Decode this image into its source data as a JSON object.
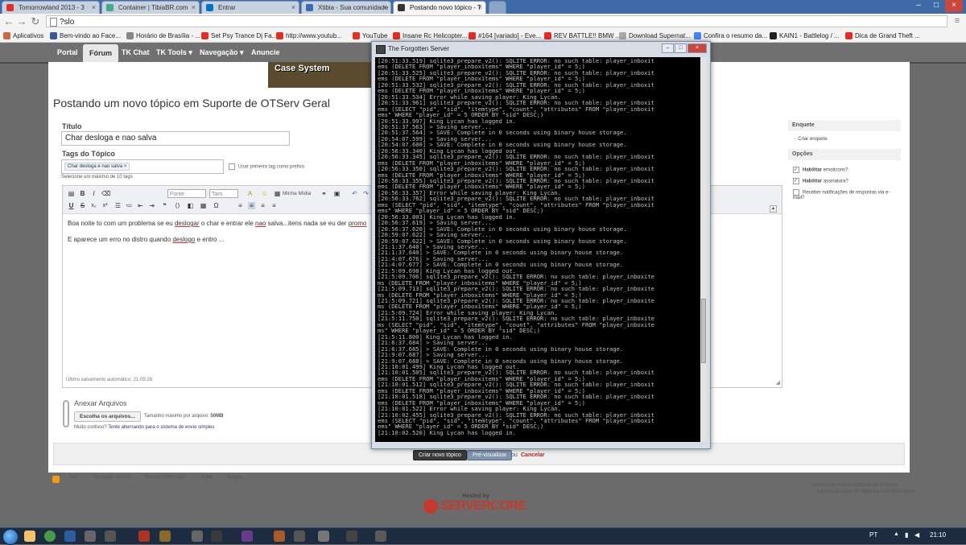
{
  "browser": {
    "tabs": [
      {
        "label": "Tomorrowland 2013 - 3",
        "color": "#e52d27"
      },
      {
        "label": "Container | TibiaBR.com",
        "color": "#4a8"
      },
      {
        "label": "Entrar",
        "color": "#0072c6"
      },
      {
        "label": "Xtibia - Sua comunidade",
        "color": "#3a6ab0"
      },
      {
        "label": "Postando novo tópico - T",
        "color": "#333"
      }
    ],
    "url": "?slo",
    "bookmarks": [
      {
        "label": "Aplicativos",
        "color": "#c64"
      },
      {
        "label": "Bem-vindo ao Face...",
        "color": "#3b5998"
      },
      {
        "label": "Horário de Brasília - ...",
        "color": "#888"
      },
      {
        "label": "Set Psy Trance Dj Fa...",
        "color": "#e52d27"
      },
      {
        "label": "http://www.youtub...",
        "color": "#e52d27"
      },
      {
        "label": "YouTube",
        "color": "#e52d27"
      },
      {
        "label": "Insane Rc Helicopter...",
        "color": "#e52d27"
      },
      {
        "label": "#164 [variado] - Eve...",
        "color": "#e52d27"
      },
      {
        "label": "REV BATTLE!! BMW ...",
        "color": "#e52d27"
      },
      {
        "label": "Download Supernat...",
        "color": "#aaa"
      },
      {
        "label": "Confira o resumo da...",
        "color": "#4285f4"
      },
      {
        "label": "KAIN1 - Battlelog / ...",
        "color": "#222"
      },
      {
        "label": "Dica de Grand Theft ...",
        "color": "#e52d27"
      }
    ]
  },
  "sitenav": [
    "Portal",
    "Fórum",
    "TK Chat",
    "TK Tools ▾",
    "Navegação ▾",
    "Anuncie"
  ],
  "banner_text": "Case System",
  "page": {
    "title": "Postando um novo tópico em Suporte de OTServ Geral",
    "titulo_label": "Título",
    "titulo_value": "Char desloga e nao salva",
    "tags_label": "Tags do Tópico",
    "tag_chip": "Char desloga e nao salva ×",
    "tag_prefix_option": "Usar primeira tag como prefixo",
    "tag_hint": "Selecione um máximo de 10 tags",
    "toolbar": {
      "font": "Fonte",
      "size": "Tam.",
      "media": "Minha Mídia"
    },
    "body_line1_pre": "Boa noite to com um problema se eu ",
    "body_w1": "deslogar",
    "body_line1_mid": " o char e entrar ele ",
    "body_w2": "nao",
    "body_line1_post": " salva...itens nada se eu der ",
    "body_w3": "promo",
    "body_line2_pre": "E aparece um erro no distro quando ",
    "body_w4": "deslogo",
    "body_line2_post": " e entro ...",
    "autosave": "Último salvamento automático: 21:09:26",
    "attach_title": "Anexar Arquivos",
    "choose_files": "Escolha os arquivos...",
    "max_size_label": "Tamanho máximo por arquivo:",
    "max_size_value": "50MB",
    "confused": "Muito confuso?",
    "alt_system": "Tente alternando para o sistema de envio simples",
    "submit": "Criar novo tópico",
    "preview": "Pré-visualizar",
    "or": "ou",
    "cancel": "Cancelar"
  },
  "sidebar": {
    "enquete": "Enquete",
    "criar_enquete": "Criar enquete",
    "opcoes": "Opções",
    "emoticons_bold": "Habilitar",
    "emoticons": "emoticons?",
    "assinatura_bold": "Habilitar",
    "assinatura": "assinatura?",
    "notify": "Receber notificações de respostas via e-mail?"
  },
  "footer": {
    "skin": "Skin",
    "lang": "Português (Brasil)",
    "mark": "Marcar Como Lido",
    "help": "Ajuda",
    "rules": "Regras",
    "software": "Community Forum Software by IP.Board",
    "license": "Licenciado para: © TibiaKing.com 2010-2014",
    "hosted": "Hosted by",
    "servercore": "SERVERCORE"
  },
  "console": {
    "title": "The Forgotten Server",
    "lines": [
      "[20:51:33.519] sqlite3_prepare_v2(): SQLITE ERROR: no such table: player_inboxit",
      "ems (DELETE FROM \"player_inboxitems\" WHERE \"player_id\" = 5;)",
      "[20:51:33.525] sqlite3_prepare_v2(): SQLITE ERROR: no such table: player_inboxit",
      "ems (DELETE FROM \"player_inboxitems\" WHERE \"player_id\" = 5;)",
      "[20:51:33.532] sqlite3_prepare_v2(): SQLITE ERROR: no such table: player_inboxit",
      "ems (DELETE FROM \"player_inboxitems\" WHERE \"player_id\" = 5;)",
      "[20:51:33.534] Error while saving player: King Lycan.",
      "[20:51:33.961] sqlite3_prepare_v2(): SQLITE ERROR: no such table: player_inboxit",
      "ems (SELECT \"pid\", \"sid\", \"itemtype\", \"count\", \"attributes\" FROM \"player_inboxit",
      "ems\" WHERE \"player_id\" = 5 ORDER BY \"sid\" DESC;)",
      "[20:51:33.997] King Lycan has logged in.",
      "[20:51:37.563] > Saving server...",
      "[20:51:37.564] > SAVE: Complete in 0 seconds using binary house storage.",
      "[20:54:07.599] > Saving server...",
      "[20:54:07.600] > SAVE: Complete in 0 seconds using binary house storage.",
      "[20:56:33.340] King Lycan has logged out.",
      "[20:56:33.345] sqlite3_prepare_v2(): SQLITE ERROR: no such table: player_inboxit",
      "ems (DELETE FROM \"player_inboxitems\" WHERE \"player_id\" = 5;)",
      "[20:56:33.350] sqlite3_prepare_v2(): SQLITE ERROR: no such table: player_inboxit",
      "ems (DELETE FROM \"player_inboxitems\" WHERE \"player_id\" = 5;)",
      "[20:56:33.355] sqlite3_prepare_v2(): SQLITE ERROR: no such table: player_inboxit",
      "ems (DELETE FROM \"player_inboxitems\" WHERE \"player_id\" = 5;)",
      "[20:56:33.357] Error while saving player: King Lycan.",
      "[20:56:33.762] sqlite3_prepare_v2(): SQLITE ERROR: no such table: player_inboxit",
      "ems (SELECT \"pid\", \"sid\", \"itemtype\", \"count\", \"attributes\" FROM \"player_inboxit",
      "ems\" WHERE \"player_id\" = 5 ORDER BY \"sid\" DESC;)",
      "[20:56:33.803] King Lycan has logged in.",
      "[20:56:37.619] > Saving server...",
      "[20:56:37.620] > SAVE: Complete in 0 seconds using binary house storage.",
      "[20:59:07.622] > Saving server...",
      "[20:59:07.622] > SAVE: Complete in 0 seconds using binary house storage.",
      "[21:1:37.640] > Saving server...",
      "[21:1:37.640] > SAVE: Complete in 0 seconds using binary house storage.",
      "[21:4:07.676] > Saving server...",
      "[21:4:07.677] > SAVE: Complete in 0 seconds using binary house storage.",
      "[21:5:09.698] King Lycan has logged out.",
      "[21:5:09.706] sqlite3_prepare_v2(): SQLITE ERROR: no such table: player_inboxite",
      "ms (DELETE FROM \"player_inboxitems\" WHERE \"player_id\" = 5;)",
      "[21:5:09.713] sqlite3_prepare_v2(): SQLITE ERROR: no such table: player_inboxite",
      "ms (DELETE FROM \"player_inboxitems\" WHERE \"player_id\" = 5;)",
      "[21:5:09.721] sqlite3_prepare_v2(): SQLITE ERROR: no such table: player_inboxite",
      "ms (DELETE FROM \"player_inboxitems\" WHERE \"player_id\" = 5;)",
      "[21:5:09.724] Error while saving player: King Lycan.",
      "[21:5:11.750] sqlite3_prepare_v2(): SQLITE ERROR: no such table: player_inboxite",
      "ms (SELECT \"pid\", \"sid\", \"itemtype\", \"count\", \"attributes\" FROM \"player_inboxite",
      "ms\" WHERE \"player_id\" = 5 ORDER BY \"sid\" DESC;)",
      "[21:5:11.800] King Lycan has logged in.",
      "[21:6:37.684] > Saving server...",
      "[21:6:37.685] > SAVE: Complete in 0 seconds using binary house storage.",
      "[21:9:07.687] > Saving server...",
      "[21:9:07.688] > SAVE: Complete in 0 seconds using binary house storage.",
      "[21:10:01.499] King Lycan has logged out.",
      "[21:10:01.505] sqlite3_prepare_v2(): SQLITE ERROR: no such table: player_inboxit",
      "ems (DELETE FROM \"player_inboxitems\" WHERE \"player_id\" = 5;)",
      "[21:10:01.512] sqlite3_prepare_v2(): SQLITE ERROR: no such table: player_inboxit",
      "ems (DELETE FROM \"player_inboxitems\" WHERE \"player_id\" = 5;)",
      "[21:10:01.518] sqlite3_prepare_v2(): SQLITE ERROR: no such table: player_inboxit",
      "ems (DELETE FROM \"player_inboxitems\" WHERE \"player_id\" = 5;)",
      "[21:10:01.522] Error while saving player: King Lycan.",
      "[21:10:02.455] sqlite3_prepare_v2(): SQLITE ERROR: no such table: player_inboxit",
      "ems (SELECT \"pid\", \"sid\", \"itemtype\", \"count\", \"attributes\" FROM \"player_inboxit",
      "ems\" WHERE \"player_id\" = 5 ORDER BY \"sid\" DESC;)",
      "[21:10:02.520] King Lycan has logged in."
    ]
  },
  "taskbar": {
    "lang": "PT",
    "time": "21:10"
  }
}
